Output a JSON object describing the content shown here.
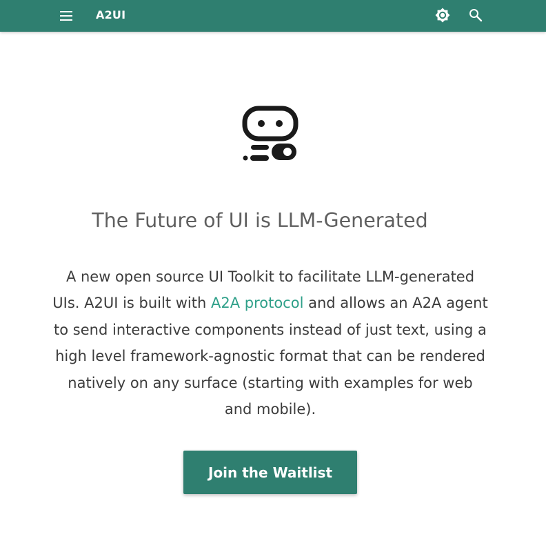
{
  "header": {
    "site_title": "A2UI",
    "menu_icon": "menu-icon",
    "theme_icon": "brightness-icon",
    "search_icon": "search-icon",
    "background_color": "#2f7f70"
  },
  "hero": {
    "logo_icon": "robot-face-icon",
    "headline": "The Future of UI is LLM-Generated",
    "description_before_link": "A new open source UI Toolkit to facilitate LLM-generated UIs. A2UI is built with ",
    "link_text": "A2A protocol",
    "description_after_link": " and allows an A2A agent to send interactive components instead of just text, using a high level framework-agnostic format that can be rendered natively on any surface (starting with examples for web and mobile).",
    "link_color": "#2fa089",
    "cta_label": "Join the Waitlist",
    "cta_color": "#2f7f70"
  }
}
